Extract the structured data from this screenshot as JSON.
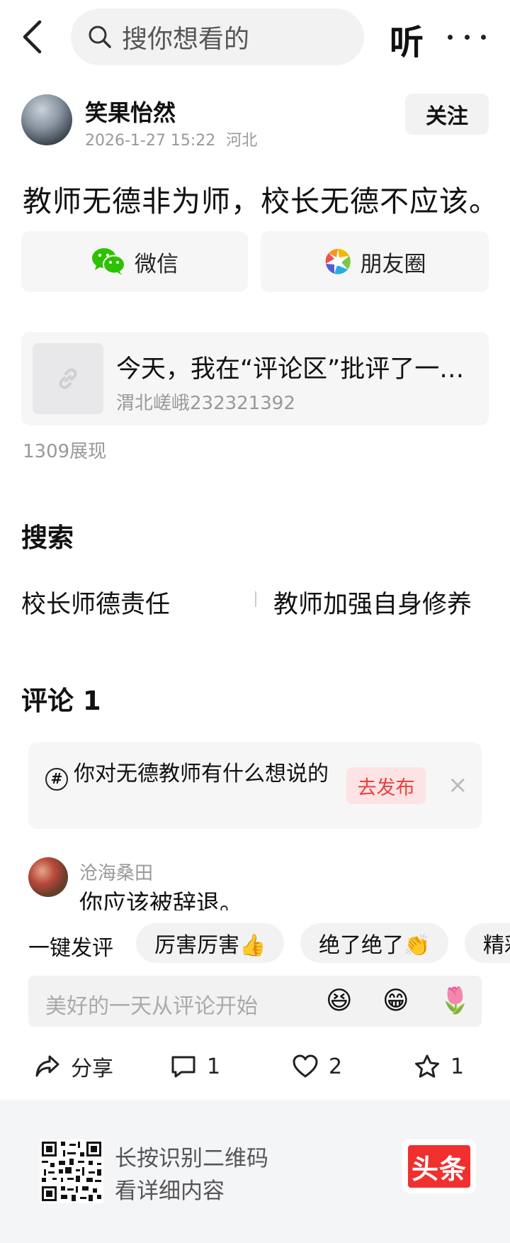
{
  "header": {
    "search_placeholder": "搜你想看的",
    "listen_label": "听"
  },
  "author": {
    "name": "笑果怡然",
    "datetime": "2026-1-27 15:22",
    "location": "河北",
    "follow_label": "关注"
  },
  "post": {
    "text": "教师无德非为师，校长无德不应该。"
  },
  "share": {
    "wechat_label": "微信",
    "moments_label": "朋友圈"
  },
  "link_card": {
    "title": "今天，我在“评论区”批评了一个无良校长",
    "source": "渭北嵯峨232321392"
  },
  "views_text": "1309展现",
  "search_section": {
    "title": "搜索",
    "suggestions": [
      "校长师德责任",
      "教师加强自身修养"
    ]
  },
  "comments": {
    "title": "评论 1",
    "prompt": {
      "text": "你对无德教师有什么想说的",
      "publish_label": "去发布",
      "close": "×"
    },
    "items": [
      {
        "user": "沧海桑田",
        "text": "你应该被辞退。"
      }
    ]
  },
  "quick_reply": {
    "label": "一键发评",
    "chips": [
      "厉害厉害👍",
      "绝了绝了👏",
      "精彩"
    ]
  },
  "composer": {
    "placeholder": "美好的一天从评论开始",
    "emojis": [
      "😆",
      "😁",
      "🌷"
    ]
  },
  "action_bar": {
    "share_label": "分享",
    "comment_count": "1",
    "like_count": "2",
    "favorite_count": "1"
  },
  "footer": {
    "qr_line1": "长按识别二维码",
    "qr_line2": "看详细内容",
    "brand": "头条"
  }
}
